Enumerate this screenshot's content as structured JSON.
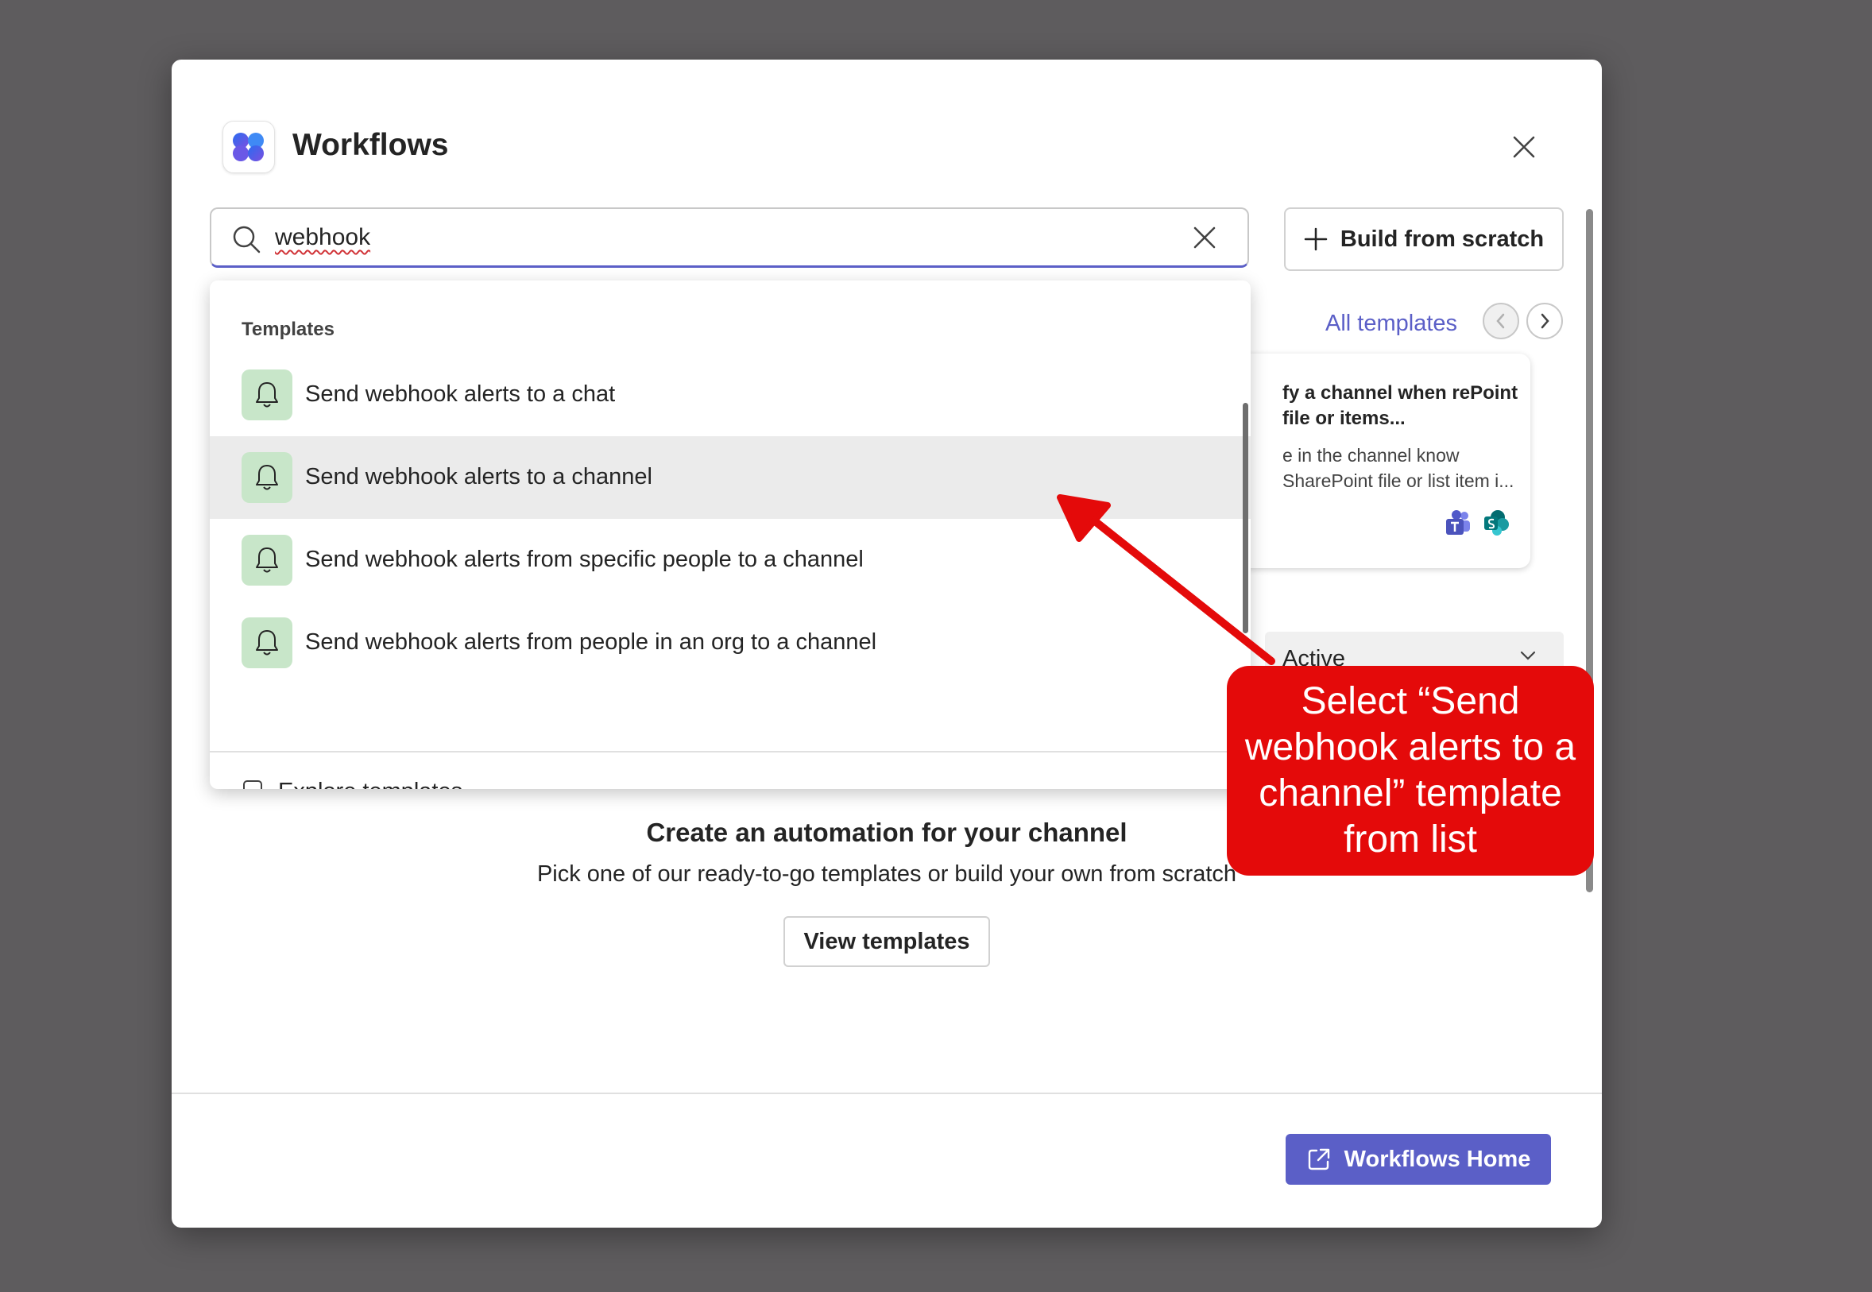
{
  "app": {
    "title": "Workflows",
    "logo_icon": "workflows-logo-icon",
    "close_icon": "close-icon"
  },
  "search": {
    "value": "webhook",
    "icon": "search-icon",
    "clear_icon": "clear-icon"
  },
  "toolbar": {
    "build_label": "Build from scratch",
    "build_icon": "plus-icon"
  },
  "carousel": {
    "all_templates_label": "All templates",
    "card": {
      "title": "fy a channel when rePoint file or items...",
      "description": "e in the channel know SharePoint file or list item i...",
      "icons": [
        "teams-icon",
        "sharepoint-icon"
      ]
    }
  },
  "status_filter": {
    "value": "Active"
  },
  "dropdown": {
    "header": "Templates",
    "items": [
      {
        "label": "Send webhook alerts to a chat",
        "selected": false
      },
      {
        "label": "Send webhook alerts to a channel",
        "selected": true
      },
      {
        "label": "Send webhook alerts from specific people to a channel",
        "selected": false
      },
      {
        "label": "Send webhook alerts from people in an org to a channel",
        "selected": false
      }
    ],
    "explore_label": "Explore templates"
  },
  "empty_state": {
    "title": "Create an automation for your channel",
    "subtitle": "Pick one of our ready-to-go templates or build your own from scratch",
    "button_label": "View templates"
  },
  "footer": {
    "home_label": "Workflows Home",
    "home_icon": "open-external-icon"
  },
  "annotation": {
    "text": "Select “Send webhook alerts to a channel” template from list"
  },
  "colors": {
    "accent": "#5b5fc7",
    "callout": "#e40a0a",
    "bell_bg": "#c8e6c9",
    "backdrop": "#5e5c5e"
  }
}
